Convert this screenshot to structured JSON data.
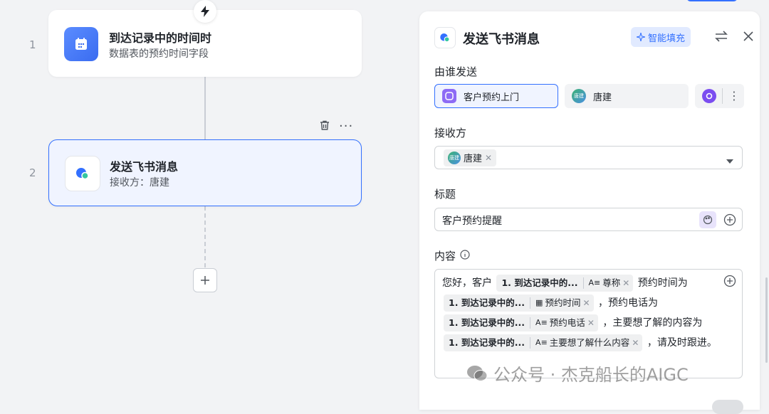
{
  "flow": {
    "steps": [
      {
        "num": "1",
        "title": "到达记录中的时间时",
        "subtitle": "数据表的预约时间字段"
      },
      {
        "num": "2",
        "title": "发送飞书消息",
        "subtitle": "接收方：唐建"
      }
    ]
  },
  "panel": {
    "title": "发送飞书消息",
    "smart_fill_label": "智能填充",
    "sender_label": "由谁发送",
    "sender_options": [
      {
        "label": "客户预约上门",
        "selected": true
      },
      {
        "label": "唐建",
        "avatar": "唐建",
        "selected": false
      }
    ],
    "receiver_label": "接收方",
    "receiver_tag": "唐建",
    "receiver_avatar": "唐建",
    "title_label": "标题",
    "title_value": "客户预约提醒",
    "content_label": "内容",
    "content": {
      "t1": "您好，客户",
      "ref_source": "1. 到达记录中的...",
      "f1": "尊称",
      "t2": "预约时间为",
      "f2": "预约时间",
      "t3": "，预约电话为",
      "f3": "预约电话",
      "t4": "，主要想了解的内容为",
      "f4": "主要想了解什么内容",
      "t5": "，请及时跟进。"
    }
  },
  "watermark": "公众号 · 杰克船长的AIGC",
  "colors": {
    "accent": "#3370ff",
    "accent_bg": "#f0f4ff",
    "app_purple": "#8d6bf5"
  }
}
